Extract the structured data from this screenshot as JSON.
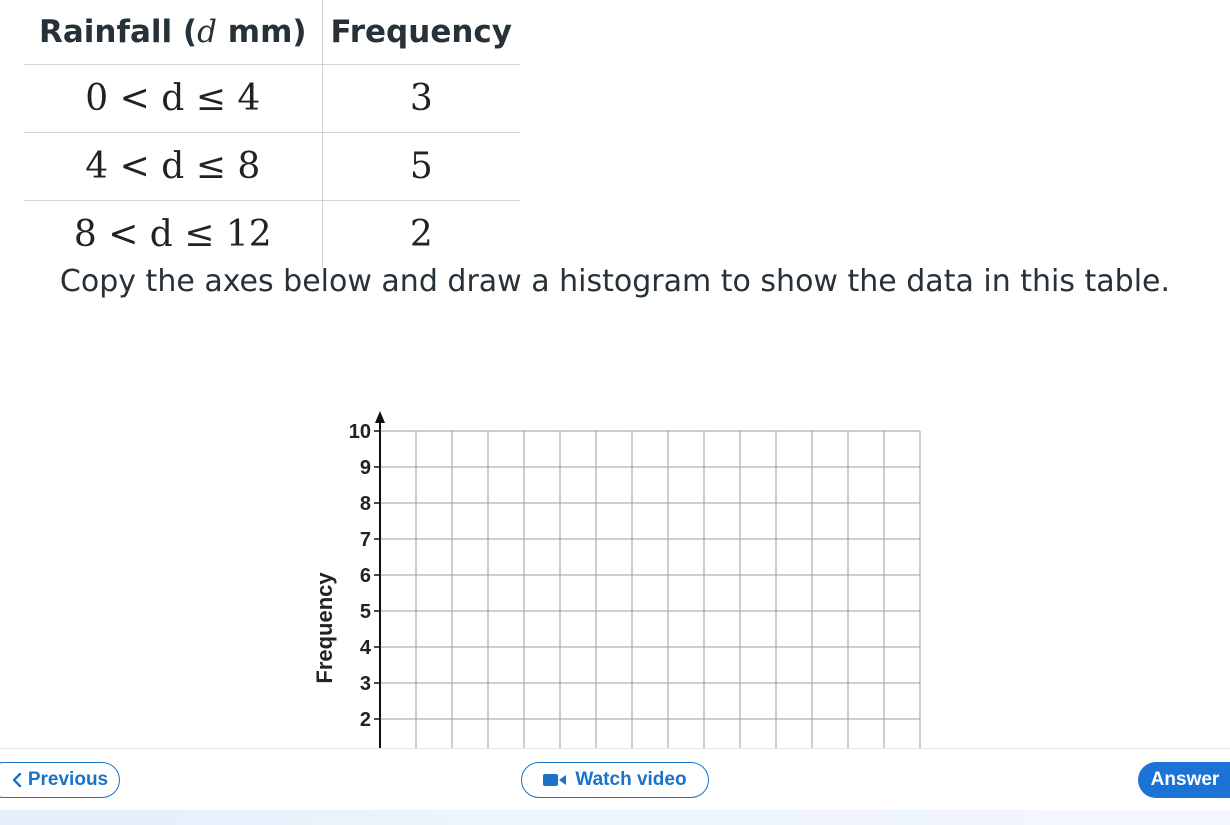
{
  "table": {
    "headers": {
      "rainfall_prefix": "Rainfall (",
      "rainfall_var": "d",
      "rainfall_suffix": " mm)",
      "frequency": "Frequency"
    },
    "rows": [
      {
        "interval": "0 < d ≤ 4",
        "frequency": "3"
      },
      {
        "interval": "4 < d ≤ 8",
        "frequency": "5"
      },
      {
        "interval": "8 < d ≤ 12",
        "frequency": "2"
      }
    ]
  },
  "question": "Copy the axes below and draw a histogram to show the data in this table.",
  "chart_data": {
    "type": "bar",
    "title": "",
    "xlabel": "",
    "ylabel": "Frequency",
    "y_ticks": [
      "10",
      "9",
      "8",
      "7",
      "6",
      "5",
      "4",
      "3",
      "2"
    ],
    "ylim_visible": [
      2,
      10
    ],
    "grid": true,
    "values": []
  },
  "nav": {
    "previous_label": "Previous",
    "watch_video_label": "Watch video",
    "answer_label": "Answer"
  },
  "colors": {
    "accent": "#1c73d6",
    "text": "#263238",
    "grid": "#9e9e9e"
  }
}
